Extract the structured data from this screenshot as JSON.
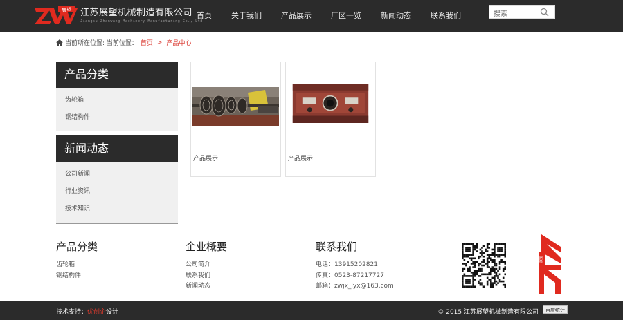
{
  "header": {
    "brand_cn": "江苏展望机械制造有限公司",
    "brand_en": "Jiangsu Zhanwang Machinery Manufacturing Co., Ltd.",
    "logo_seal": "展望",
    "nav": [
      "首页",
      "关于我们",
      "产品展示",
      "厂区一览",
      "新闻动态",
      "联系我们"
    ],
    "search_placeholder": "搜索"
  },
  "breadcrumb": {
    "prefix": "当前所在位置: 当前位置：",
    "home": "首页",
    "sep": ">",
    "current": "产品中心"
  },
  "sidebar": {
    "products": {
      "title": "产品分类",
      "items": [
        "齿轮箱",
        "钢结构件"
      ]
    },
    "news": {
      "title": "新闻动态",
      "items": [
        "公司新闻",
        "行业资讯",
        "技术知识"
      ]
    }
  },
  "products": [
    {
      "caption": "产品展示",
      "image": "gear-shafts-photo"
    },
    {
      "caption": "产品展示",
      "image": "gearbox-housing-photo"
    }
  ],
  "footer": {
    "col1": {
      "title": "产品分类",
      "items": [
        "齿轮箱",
        "钢结构件"
      ]
    },
    "col2": {
      "title": "企业概要",
      "items": [
        "公司简介",
        "联系我们",
        "新闻动态"
      ]
    },
    "col3": {
      "title": "联系我们",
      "items": [
        "电话：13915202821",
        "传真：0523-87217727",
        "邮箱：zwjx_lyx@163.com"
      ]
    },
    "logo_seal": "展望"
  },
  "bottom": {
    "support_prefix": "技术支持：",
    "support_name": "优创企",
    "support_suffix": "设计",
    "copyright": "© 2015 江苏展望机械制造有限公司",
    "stats_badge": "百度统计"
  },
  "colors": {
    "dark": "#2b2b2b",
    "accent": "#d9342b"
  }
}
